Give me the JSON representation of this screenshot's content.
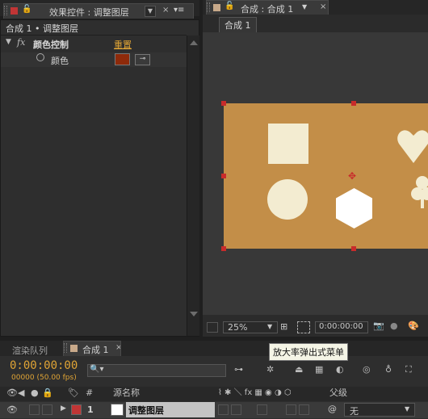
{
  "effect_panel": {
    "tab_title": "效果控件 : 调整图层",
    "breadcrumb": "合成 1 • 调整图层",
    "effect_name": "颜色控制",
    "reset_label": "重置",
    "property_label": "颜色",
    "fx_label": "fx",
    "color_value": "#8e2a0a"
  },
  "comp_panel": {
    "tab_title": "合成 : 合成 1",
    "subtab_label": "合成 1",
    "zoom": "25%",
    "timecode": "0:00:00:00",
    "background_color": "#c38e48"
  },
  "timeline": {
    "tab_render_queue": "渲染队列",
    "tab_comp": "合成 1",
    "timecode": "0:00:00:00",
    "frame_info": "00000 (50.00 fps)",
    "search_placeholder": "",
    "tooltip": "放大率弹出式菜单",
    "col_hash": "#",
    "col_source": "源名称",
    "col_parent": "父级",
    "layer_number": "1",
    "layer_name": "调整图层",
    "layer_parent": "无",
    "layer_color": "#c13535"
  }
}
